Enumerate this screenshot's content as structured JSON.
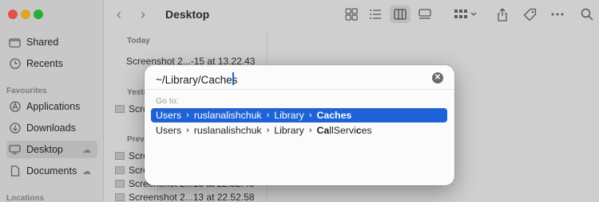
{
  "window": {
    "title": "Desktop"
  },
  "sidebar": {
    "items_top": [
      {
        "label": "Shared",
        "icon": "shared-folder-icon"
      },
      {
        "label": "Recents",
        "icon": "clock-icon"
      }
    ],
    "favourites_heading": "Favourites",
    "favourites": [
      {
        "label": "Applications",
        "icon": "applications-icon"
      },
      {
        "label": "Downloads",
        "icon": "download-icon"
      },
      {
        "label": "Desktop",
        "icon": "desktop-icon"
      },
      {
        "label": "Documents",
        "icon": "document-icon"
      }
    ],
    "locations_heading": "Locations"
  },
  "file_list": {
    "today_heading": "Today",
    "today_files": [
      {
        "name": "Screenshot 2...-15 at 13.22.43"
      }
    ],
    "yesterday_heading": "Yeste",
    "yesterday_files": [
      {
        "name": "Scre"
      }
    ],
    "previous_heading": "Previ",
    "previous_files": [
      {
        "name": "Scre"
      },
      {
        "name": "Scre"
      },
      {
        "name": "Screenshot 2...13 at 22.52.49"
      },
      {
        "name": "Screenshot 2...13 at 22.52.58"
      }
    ]
  },
  "dialog": {
    "path_value": "~/Library/Caches",
    "clear_symbol": "✕",
    "goto_label": "Go to:",
    "suggestions": [
      {
        "parts": [
          "Users",
          "ruslanalishchuk",
          "Library"
        ],
        "last_bold": "Caches",
        "last_rest": "",
        "selected": true
      },
      {
        "parts": [
          "Users",
          "ruslanalishchuk",
          "Library"
        ],
        "last_bold": "Ca",
        "last_mid": "llServi",
        "last_bold2": "c",
        "last_end": "es",
        "selected": false
      }
    ],
    "separator": "›"
  }
}
